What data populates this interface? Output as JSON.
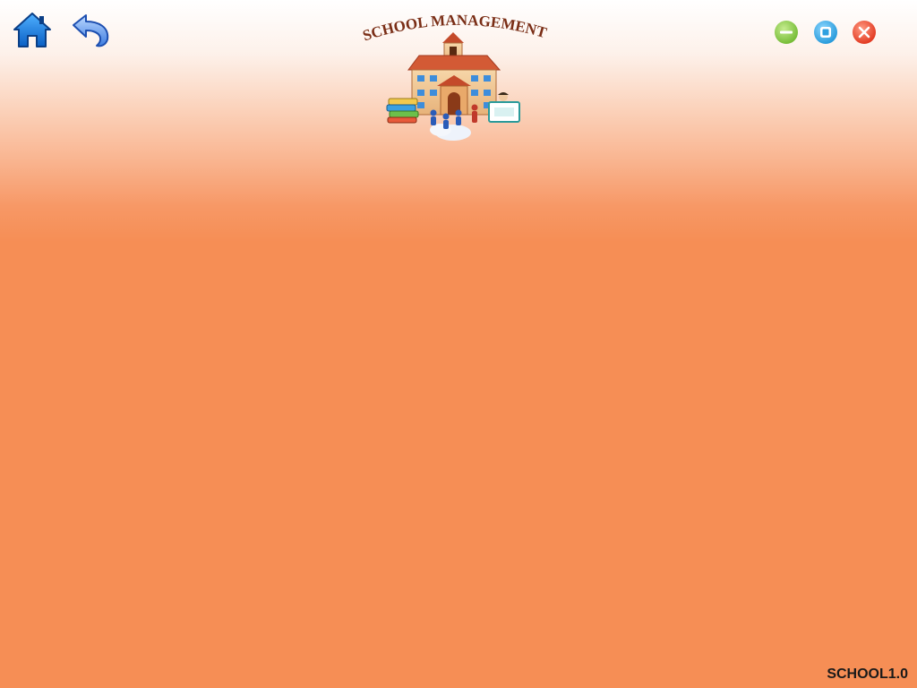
{
  "header": {
    "logo_text": "SCHOOL MANAGEMENT",
    "home_icon": "home-icon",
    "back_icon": "back-arrow-icon"
  },
  "window_controls": {
    "minimize_icon": "minimize-icon",
    "maximize_icon": "maximize-icon",
    "close_icon": "close-icon"
  },
  "footer": {
    "version": "SCHOOL1.0"
  },
  "colors": {
    "background": "#f68e55",
    "logo_text": "#7a2e16",
    "minimize": "#8bc34a",
    "maximize": "#29a8e0",
    "close": "#e8412c",
    "nav_icon": "#1f7fe0"
  }
}
